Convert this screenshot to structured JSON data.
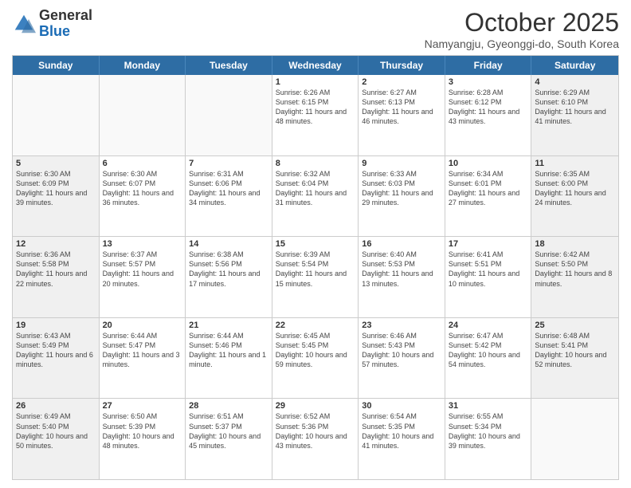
{
  "header": {
    "logo": {
      "general": "General",
      "blue": "Blue"
    },
    "title": "October 2025",
    "subtitle": "Namyangju, Gyeonggi-do, South Korea"
  },
  "calendar": {
    "days": [
      "Sunday",
      "Monday",
      "Tuesday",
      "Wednesday",
      "Thursday",
      "Friday",
      "Saturday"
    ],
    "rows": [
      [
        {
          "day": "",
          "info": "",
          "empty": true
        },
        {
          "day": "",
          "info": "",
          "empty": true
        },
        {
          "day": "",
          "info": "",
          "empty": true
        },
        {
          "day": "1",
          "info": "Sunrise: 6:26 AM\nSunset: 6:15 PM\nDaylight: 11 hours\nand 48 minutes."
        },
        {
          "day": "2",
          "info": "Sunrise: 6:27 AM\nSunset: 6:13 PM\nDaylight: 11 hours\nand 46 minutes."
        },
        {
          "day": "3",
          "info": "Sunrise: 6:28 AM\nSunset: 6:12 PM\nDaylight: 11 hours\nand 43 minutes."
        },
        {
          "day": "4",
          "info": "Sunrise: 6:29 AM\nSunset: 6:10 PM\nDaylight: 11 hours\nand 41 minutes.",
          "shaded": true
        }
      ],
      [
        {
          "day": "5",
          "info": "Sunrise: 6:30 AM\nSunset: 6:09 PM\nDaylight: 11 hours\nand 39 minutes.",
          "shaded": true
        },
        {
          "day": "6",
          "info": "Sunrise: 6:30 AM\nSunset: 6:07 PM\nDaylight: 11 hours\nand 36 minutes."
        },
        {
          "day": "7",
          "info": "Sunrise: 6:31 AM\nSunset: 6:06 PM\nDaylight: 11 hours\nand 34 minutes."
        },
        {
          "day": "8",
          "info": "Sunrise: 6:32 AM\nSunset: 6:04 PM\nDaylight: 11 hours\nand 31 minutes."
        },
        {
          "day": "9",
          "info": "Sunrise: 6:33 AM\nSunset: 6:03 PM\nDaylight: 11 hours\nand 29 minutes."
        },
        {
          "day": "10",
          "info": "Sunrise: 6:34 AM\nSunset: 6:01 PM\nDaylight: 11 hours\nand 27 minutes."
        },
        {
          "day": "11",
          "info": "Sunrise: 6:35 AM\nSunset: 6:00 PM\nDaylight: 11 hours\nand 24 minutes.",
          "shaded": true
        }
      ],
      [
        {
          "day": "12",
          "info": "Sunrise: 6:36 AM\nSunset: 5:58 PM\nDaylight: 11 hours\nand 22 minutes.",
          "shaded": true
        },
        {
          "day": "13",
          "info": "Sunrise: 6:37 AM\nSunset: 5:57 PM\nDaylight: 11 hours\nand 20 minutes."
        },
        {
          "day": "14",
          "info": "Sunrise: 6:38 AM\nSunset: 5:56 PM\nDaylight: 11 hours\nand 17 minutes."
        },
        {
          "day": "15",
          "info": "Sunrise: 6:39 AM\nSunset: 5:54 PM\nDaylight: 11 hours\nand 15 minutes."
        },
        {
          "day": "16",
          "info": "Sunrise: 6:40 AM\nSunset: 5:53 PM\nDaylight: 11 hours\nand 13 minutes."
        },
        {
          "day": "17",
          "info": "Sunrise: 6:41 AM\nSunset: 5:51 PM\nDaylight: 11 hours\nand 10 minutes."
        },
        {
          "day": "18",
          "info": "Sunrise: 6:42 AM\nSunset: 5:50 PM\nDaylight: 11 hours\nand 8 minutes.",
          "shaded": true
        }
      ],
      [
        {
          "day": "19",
          "info": "Sunrise: 6:43 AM\nSunset: 5:49 PM\nDaylight: 11 hours\nand 6 minutes.",
          "shaded": true
        },
        {
          "day": "20",
          "info": "Sunrise: 6:44 AM\nSunset: 5:47 PM\nDaylight: 11 hours\nand 3 minutes."
        },
        {
          "day": "21",
          "info": "Sunrise: 6:44 AM\nSunset: 5:46 PM\nDaylight: 11 hours\nand 1 minute."
        },
        {
          "day": "22",
          "info": "Sunrise: 6:45 AM\nSunset: 5:45 PM\nDaylight: 10 hours\nand 59 minutes."
        },
        {
          "day": "23",
          "info": "Sunrise: 6:46 AM\nSunset: 5:43 PM\nDaylight: 10 hours\nand 57 minutes."
        },
        {
          "day": "24",
          "info": "Sunrise: 6:47 AM\nSunset: 5:42 PM\nDaylight: 10 hours\nand 54 minutes."
        },
        {
          "day": "25",
          "info": "Sunrise: 6:48 AM\nSunset: 5:41 PM\nDaylight: 10 hours\nand 52 minutes.",
          "shaded": true
        }
      ],
      [
        {
          "day": "26",
          "info": "Sunrise: 6:49 AM\nSunset: 5:40 PM\nDaylight: 10 hours\nand 50 minutes.",
          "shaded": true
        },
        {
          "day": "27",
          "info": "Sunrise: 6:50 AM\nSunset: 5:39 PM\nDaylight: 10 hours\nand 48 minutes."
        },
        {
          "day": "28",
          "info": "Sunrise: 6:51 AM\nSunset: 5:37 PM\nDaylight: 10 hours\nand 45 minutes."
        },
        {
          "day": "29",
          "info": "Sunrise: 6:52 AM\nSunset: 5:36 PM\nDaylight: 10 hours\nand 43 minutes."
        },
        {
          "day": "30",
          "info": "Sunrise: 6:54 AM\nSunset: 5:35 PM\nDaylight: 10 hours\nand 41 minutes."
        },
        {
          "day": "31",
          "info": "Sunrise: 6:55 AM\nSunset: 5:34 PM\nDaylight: 10 hours\nand 39 minutes."
        },
        {
          "day": "",
          "info": "",
          "empty": true,
          "shaded": true
        }
      ]
    ]
  }
}
